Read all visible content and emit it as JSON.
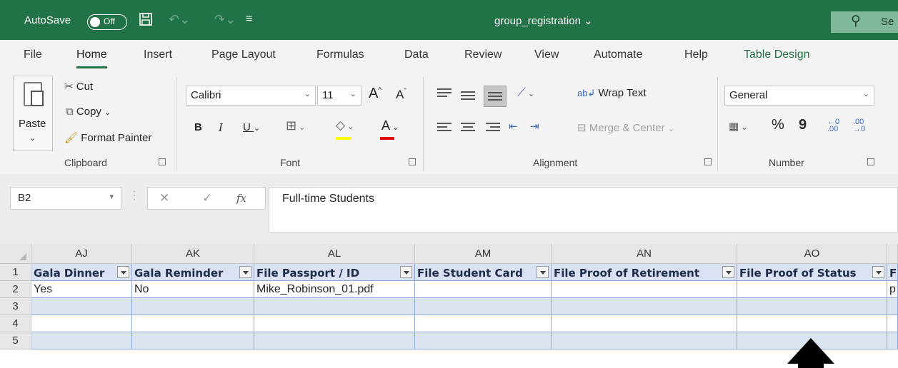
{
  "titlebar": {
    "autosave_label": "AutoSave",
    "autosave_state": "Off",
    "doc_title": "group_registration",
    "search_fragment": "Se"
  },
  "tabs": [
    "File",
    "Home",
    "Insert",
    "Page Layout",
    "Formulas",
    "Data",
    "Review",
    "View",
    "Automate",
    "Help",
    "Table Design"
  ],
  "active_tab": "Home",
  "ribbon": {
    "clipboard": {
      "paste": "Paste",
      "cut": "Cut",
      "copy": "Copy",
      "format_painter": "Format Painter",
      "label": "Clipboard"
    },
    "font": {
      "name": "Calibri",
      "size": "11",
      "label": "Font",
      "bold": "B",
      "italic": "I",
      "underline": "U",
      "grow": "A",
      "shrink": "A",
      "color_letter": "A"
    },
    "alignment": {
      "wrap_text": "Wrap Text",
      "merge_center": "Merge & Center",
      "label": "Alignment"
    },
    "number": {
      "format": "General",
      "percent": "%",
      "comma": "9",
      "label": "Number"
    }
  },
  "formula_bar": {
    "name_box": "B2",
    "fx": "fx",
    "content": "Full-time Students"
  },
  "grid": {
    "columns": [
      "AJ",
      "AK",
      "AL",
      "AM",
      "AN",
      "AO"
    ],
    "rows": [
      "1",
      "2",
      "3",
      "4",
      "5"
    ],
    "headers": [
      "Gala Dinner",
      "Gala Reminder",
      "File Passport / ID",
      "File Student Card",
      "File Proof of Retirement",
      "File Proof of Status",
      "F"
    ],
    "row2": [
      "Yes",
      "No",
      "Mike_Robinson_01.pdf",
      "",
      "",
      "",
      "p"
    ]
  },
  "colors": {
    "titlebar": "#217346",
    "table_header": "#d9e1f2",
    "table_band": "#dbe5f1",
    "table_border": "#8ea9db"
  }
}
